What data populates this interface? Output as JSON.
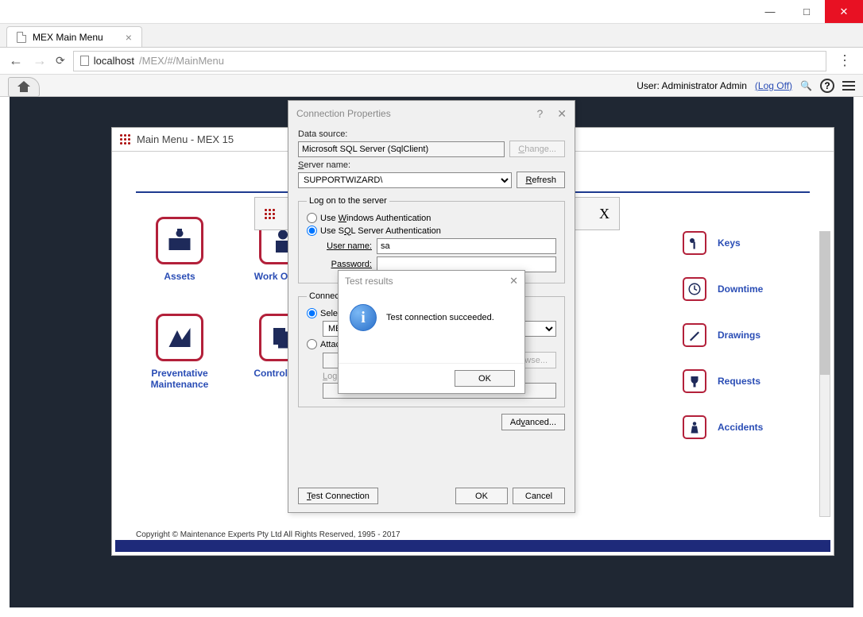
{
  "window": {
    "minimize": "—",
    "maximize": "□",
    "close": "✕"
  },
  "browser": {
    "tab_title": "MEX Main Menu",
    "url_host": "localhost",
    "url_path": "/MEX/#/MainMenu"
  },
  "app_header": {
    "user_label": "User: Administrator Admin",
    "logoff": "(Log Off)",
    "search_glyph": "🔍",
    "help_glyph": "?"
  },
  "main_menu": {
    "title": "Main Menu - MEX 15",
    "items": [
      {
        "label": "Assets"
      },
      {
        "label": "Work Orders"
      },
      {
        "label": "Preventative Maintenance"
      },
      {
        "label": "Control Files"
      }
    ],
    "side_items": [
      {
        "label": "Keys"
      },
      {
        "label": "Downtime"
      },
      {
        "label": "Drawings"
      },
      {
        "label": "Requests"
      },
      {
        "label": "Accidents"
      }
    ],
    "copyright": "Copyright © Maintenance Experts Pty Ltd All Rights Reserved, 1995 - 2017"
  },
  "sub_dialog": {
    "close": "X"
  },
  "conn": {
    "title": "Connection Properties",
    "help": "?",
    "close": "✕",
    "data_source_label": "Data source:",
    "data_source_value": "Microsoft SQL Server (SqlClient)",
    "change_btn": "Change...",
    "server_name_label": "Server name:",
    "server_name_value": "SUPPORTWIZARD\\",
    "refresh_btn": "Refresh",
    "logon_legend": "Log on to the server",
    "auth_windows": "Use Windows Authentication",
    "auth_sql": "Use SQL Server Authentication",
    "user_label": "User name:",
    "user_value": "sa",
    "pass_label": "Password:",
    "pass_value": "",
    "connect_legend": "Connect to a database",
    "select_radio": "Select or enter a database name:",
    "select_value": "MEX",
    "attach_radio": "Attach a database file:",
    "browse_btn": "Browse...",
    "logical_label": "Logical name:",
    "advanced_btn": "Advanced...",
    "test_btn": "Test Connection",
    "ok_btn": "OK",
    "cancel_btn": "Cancel"
  },
  "popup": {
    "title": "Test results",
    "close": "✕",
    "message": "Test connection succeeded.",
    "ok_btn": "OK"
  }
}
